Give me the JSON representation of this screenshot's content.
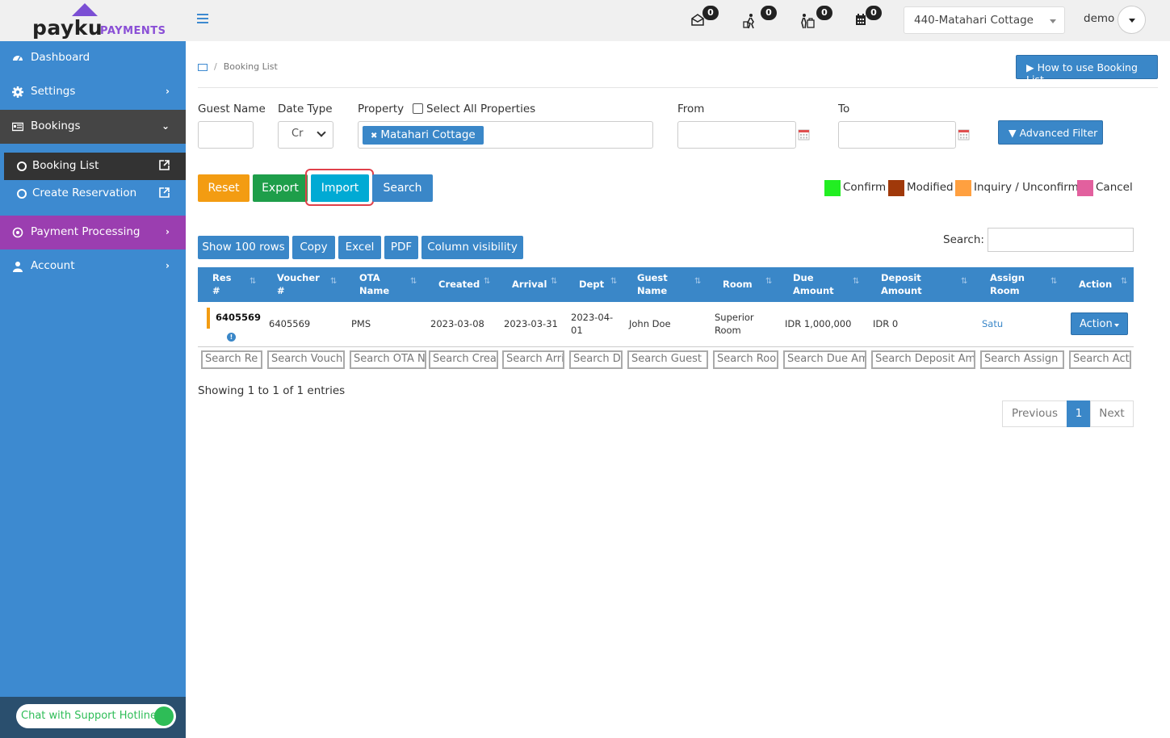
{
  "brand": {
    "name": "payku",
    "sub": "PAYMENTS"
  },
  "header": {
    "badges": [
      "0",
      "0",
      "0",
      "0"
    ],
    "property_select": "440-Matahari Cottage",
    "user": "demo"
  },
  "sidebar": {
    "items": [
      {
        "label": "Dashboard"
      },
      {
        "label": "Settings"
      },
      {
        "label": "Bookings"
      },
      {
        "label": "Payment Processing"
      },
      {
        "label": "Account"
      }
    ],
    "sub_items": [
      {
        "label": "Booking List"
      },
      {
        "label": "Create Reservation"
      }
    ],
    "chat_label": "Chat with Support Hotline"
  },
  "breadcrumb": {
    "current": "Booking List"
  },
  "howto_label": "How to use Booking List",
  "filters": {
    "guest_name_label": "Guest Name",
    "date_type_label": "Date Type",
    "date_type_value": "Cr",
    "property_label": "Property",
    "select_all_label": "Select All Properties",
    "property_tag": "Matahari Cottage",
    "from_label": "From",
    "to_label": "To",
    "advanced_filter_label": "Advanced Filter"
  },
  "actions": {
    "reset": "Reset",
    "export": "Export",
    "import": "Import",
    "search": "Search"
  },
  "legend": [
    {
      "label": "Confirm",
      "color": "#22ee22"
    },
    {
      "label": "Modified",
      "color": "#a0390a"
    },
    {
      "label": "Inquiry / Unconfirm",
      "color": "#ffa040"
    },
    {
      "label": "Cancel",
      "color": "#e2609e"
    }
  ],
  "table_tools": {
    "show_rows": "Show 100 rows",
    "copy": "Copy",
    "excel": "Excel",
    "pdf": "PDF",
    "column_visibility": "Column visibility",
    "search_label": "Search:"
  },
  "table": {
    "columns": [
      {
        "line1": "Res",
        "line2": "#"
      },
      {
        "line1": "Voucher",
        "line2": "#"
      },
      {
        "line1": "OTA",
        "line2": "Name"
      },
      {
        "line1": "Created",
        "line2": ""
      },
      {
        "line1": "Arrival",
        "line2": ""
      },
      {
        "line1": "Dept",
        "line2": ""
      },
      {
        "line1": "Guest",
        "line2": "Name"
      },
      {
        "line1": "Room",
        "line2": ""
      },
      {
        "line1": "Due",
        "line2": "Amount"
      },
      {
        "line1": "Deposit",
        "line2": "Amount"
      },
      {
        "line1": "Assign",
        "line2": "Room"
      },
      {
        "line1": "Action",
        "line2": ""
      }
    ],
    "rows": [
      {
        "res": "6405569",
        "voucher": "6405569",
        "ota": "PMS",
        "created": "2023-03-08",
        "arrival": "2023-03-31",
        "dept_line1": "2023-04-",
        "dept_line2": "01",
        "guest": "John Doe",
        "room_line1": "Superior",
        "room_line2": "Room",
        "due": "IDR 1,000,000",
        "deposit": "IDR 0",
        "assign": "Satu",
        "action": "Action"
      }
    ],
    "column_search": [
      "Search Re",
      "Search Vouch",
      "Search OTA N",
      "Search Crea",
      "Search Arri",
      "Search D",
      "Search Guest",
      "Search Roo",
      "Search Due Am",
      "Search Deposit Am",
      "Search Assign",
      "Search Act"
    ]
  },
  "footer": {
    "showing": "Showing 1 to 1 of 1 entries",
    "previous": "Previous",
    "page": "1",
    "next": "Next"
  }
}
